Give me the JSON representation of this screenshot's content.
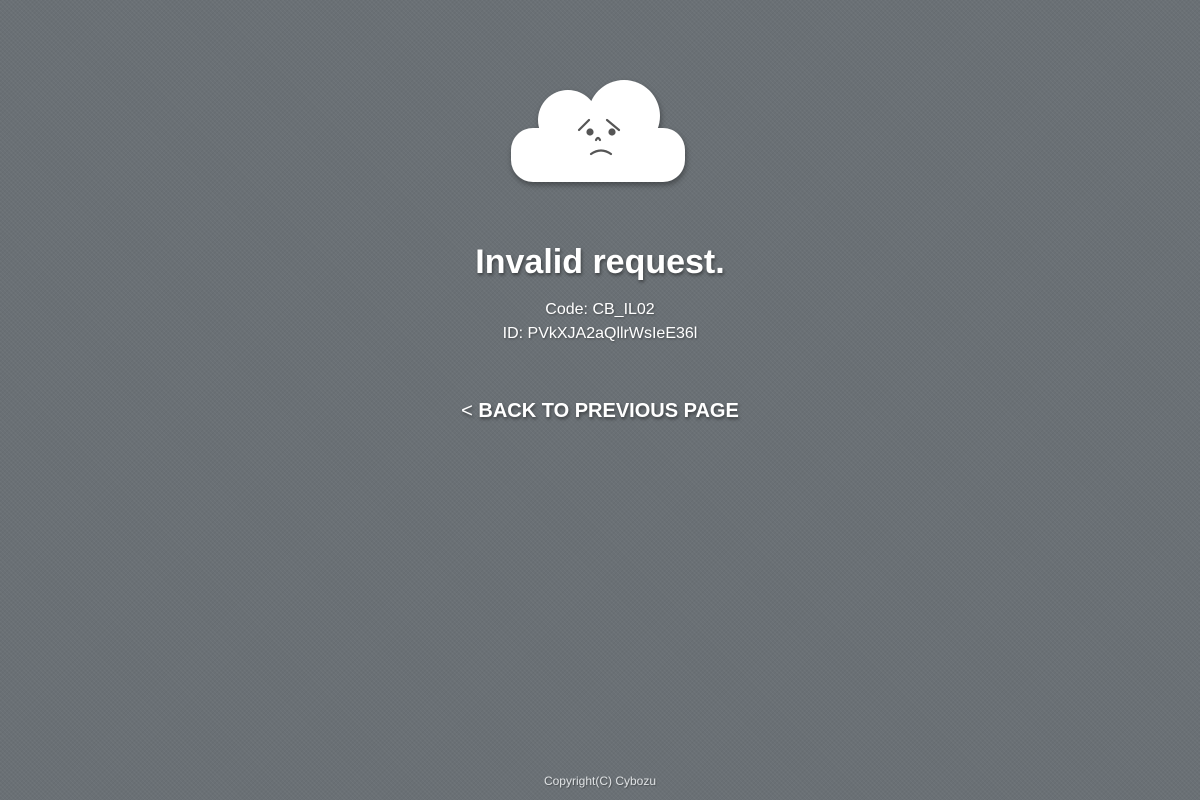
{
  "error": {
    "icon": "sad-cloud-icon",
    "title": "Invalid request.",
    "code_line": "Code: CB_IL02",
    "id_line": "ID: PVkXJA2aQllrWsIeE36l"
  },
  "navigation": {
    "back_prefix": "<",
    "back_label": "BACK TO PREVIOUS PAGE"
  },
  "footer": {
    "copyright": "Copyright(C) Cybozu"
  },
  "colors": {
    "background": "#6a7075",
    "text": "#ffffff",
    "cloud": "#ffffff",
    "face": "#555555"
  }
}
